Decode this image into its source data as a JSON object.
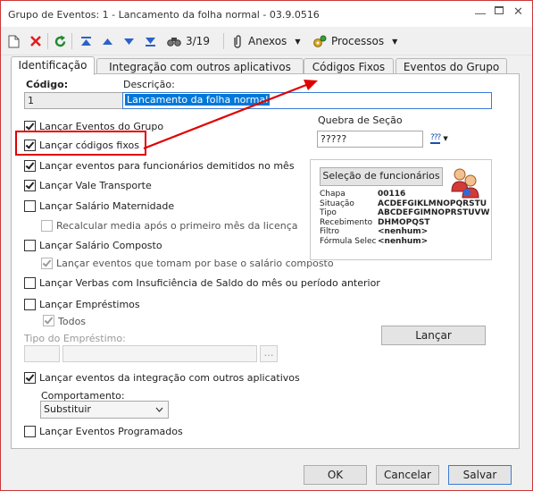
{
  "window": {
    "title": "Grupo de Eventos: 1 - Lancamento da folha normal - 03.9.0516"
  },
  "toolbar": {
    "record_counter": "3/19",
    "anexos_label": "Anexos",
    "processos_label": "Processos"
  },
  "tabs": [
    {
      "label": "Identificação",
      "active": true
    },
    {
      "label": "Integração com outros aplicativos",
      "active": false
    },
    {
      "label": "Códigos Fixos",
      "active": false
    },
    {
      "label": "Eventos do Grupo",
      "active": false
    }
  ],
  "form": {
    "codigo_label": "Código:",
    "codigo_value": "1",
    "descricao_label": "Descrição:",
    "descricao_value": "Lancamento da folha normal",
    "options": {
      "lancar_eventos_grupo": "Lançar Eventos do Grupo",
      "lancar_codigos_fixos": "Lançar códigos fixos",
      "lancar_demitidos": "Lançar eventos para funcionários demitidos no mês",
      "lancar_vale_transporte": "Lançar Vale Transporte",
      "lancar_salario_maternidade": "Lançar Salário Maternidade",
      "recalcular_media": "Recalcular media após o primeiro mês da licença",
      "lancar_salario_composto": "Lançar Salário Composto",
      "lancar_eventos_base": "Lançar eventos que tomam por base o salário composto",
      "lancar_verbas_insuficiencia": "Lançar Verbas com Insuficiência de Saldo do mês ou período anterior",
      "lancar_emprestimos": "Lançar Empréstimos",
      "todos": "Todos",
      "lancar_integracao": "Lançar eventos da integração com outros aplicativos",
      "lancar_programados": "Lançar Eventos Programados"
    },
    "tipo_emprestimo_label": "Tipo do Empréstimo:",
    "comportamento_label": "Comportamento:",
    "comportamento_value": "Substituir",
    "lancar_button": "Lançar"
  },
  "quebra": {
    "label": "Quebra de Seção",
    "value": "?????",
    "lookup_glyph": "???"
  },
  "selecao": {
    "button_label": "Seleção de funcionários",
    "fields": [
      {
        "label": "Chapa",
        "value": "00116"
      },
      {
        "label": "Situação",
        "value": "ACDEFGIKLMNOPQRSTU"
      },
      {
        "label": "Tipo",
        "value": "ABCDEFGIMNOPRSTUVW"
      },
      {
        "label": "Recebimento",
        "value": "DHMOPQST"
      },
      {
        "label": "Filtro",
        "value": "<nenhum>"
      },
      {
        "label": "Fórmula Selec",
        "value": "<nenhum>"
      }
    ]
  },
  "footer": {
    "ok_label": "OK",
    "cancelar_label": "Cancelar",
    "salvar_label": "Salvar"
  },
  "colors": {
    "annotation_red": "#e00000",
    "accent_blue": "#3a7bd5",
    "selection_blue": "#0078d7"
  }
}
